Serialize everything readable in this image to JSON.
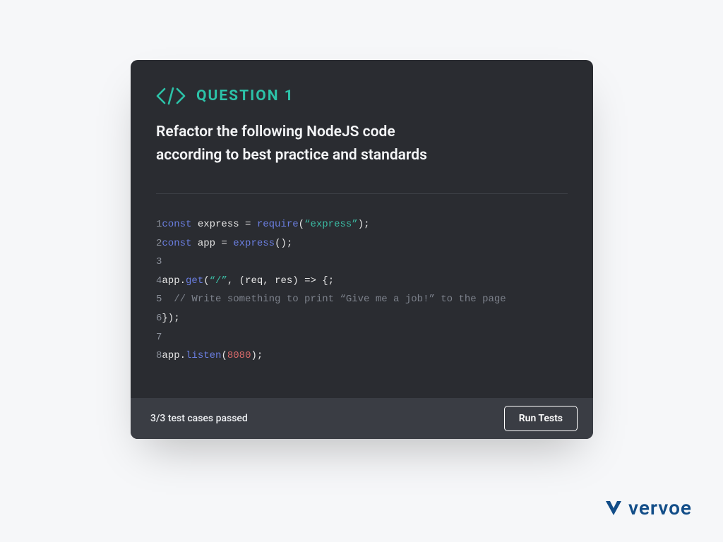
{
  "colors": {
    "accent": "#2cc2a8",
    "panel_bg": "#2a2c31",
    "footer_bg": "#3a3d44",
    "brand": "#124d88"
  },
  "question": {
    "title": "QUESTION 1",
    "prompt_line1": "Refactor the following NodeJS code",
    "prompt_line2": "according to best practice and standards"
  },
  "code": {
    "lines": [
      {
        "n": "1",
        "segments": [
          {
            "t": "const ",
            "c": "kw"
          },
          {
            "t": "express = ",
            "c": "id"
          },
          {
            "t": "require",
            "c": "fn"
          },
          {
            "t": "(",
            "c": "pun"
          },
          {
            "t": "“express”",
            "c": "str"
          },
          {
            "t": ");",
            "c": "pun"
          }
        ]
      },
      {
        "n": "2",
        "segments": [
          {
            "t": "const ",
            "c": "kw"
          },
          {
            "t": "app = ",
            "c": "id"
          },
          {
            "t": "express",
            "c": "fn"
          },
          {
            "t": "();",
            "c": "pun"
          }
        ]
      },
      {
        "n": "3",
        "segments": []
      },
      {
        "n": "4",
        "segments": [
          {
            "t": "app",
            "c": "id"
          },
          {
            "t": ".",
            "c": "pun"
          },
          {
            "t": "get",
            "c": "fn"
          },
          {
            "t": "(",
            "c": "pun"
          },
          {
            "t": "“/”",
            "c": "str"
          },
          {
            "t": ", (req, res) => {;",
            "c": "pun"
          }
        ]
      },
      {
        "n": "5",
        "segments": [
          {
            "t": "  // Write something to print “Give me a job!” to the page",
            "c": "comment"
          }
        ]
      },
      {
        "n": "6",
        "segments": [
          {
            "t": "});",
            "c": "pun"
          }
        ]
      },
      {
        "n": "7",
        "segments": []
      },
      {
        "n": "8",
        "segments": [
          {
            "t": "app",
            "c": "id"
          },
          {
            "t": ".",
            "c": "pun"
          },
          {
            "t": "listen",
            "c": "fn"
          },
          {
            "t": "(",
            "c": "pun"
          },
          {
            "t": "8080",
            "c": "num"
          },
          {
            "t": ");",
            "c": "pun"
          }
        ]
      }
    ]
  },
  "footer": {
    "status": "3/3 test cases passed",
    "run_label": "Run Tests"
  },
  "brand": {
    "name": "vervoe"
  }
}
